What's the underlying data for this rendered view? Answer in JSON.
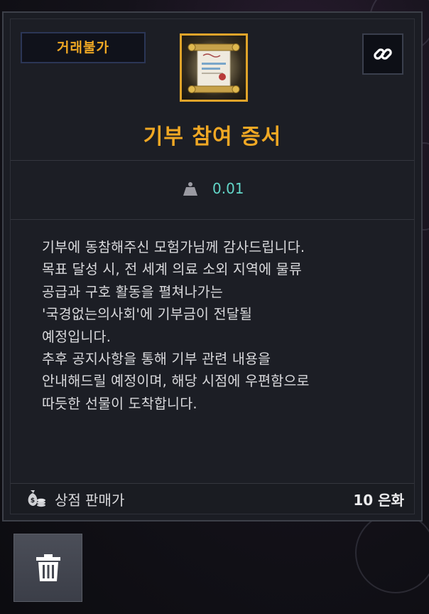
{
  "tooltip": {
    "badge_label": "거래불가",
    "item_name": "기부 참여 증서",
    "item_icon": "donation-certificate-scroll-icon",
    "link_icon": "link-icon",
    "weight_icon": "weight-icon",
    "weight_value": "0.01",
    "description": "기부에 동참해주신 모험가님께 감사드립니다.\n목표 달성 시, 전 세계 의료 소외 지역에 물류\n공급과 구호 활동을 펼쳐나가는\n'국경없는의사회'에 기부금이 전달될\n예정입니다.\n추후 공지사항을 통해 기부 관련 내용을\n안내해드릴 예정이며, 해당 시점에 우편함으로\n따듯한 선물이 도착합니다.",
    "sell_icon": "money-bag-icon",
    "sell_label": "상점 판매가",
    "sell_value": "10 은화"
  },
  "actions": {
    "delete_icon": "trash-icon"
  },
  "colors": {
    "accent_gold": "#f0a824",
    "weight_teal": "#62d6c8",
    "panel_bg": "#1b1d24"
  }
}
